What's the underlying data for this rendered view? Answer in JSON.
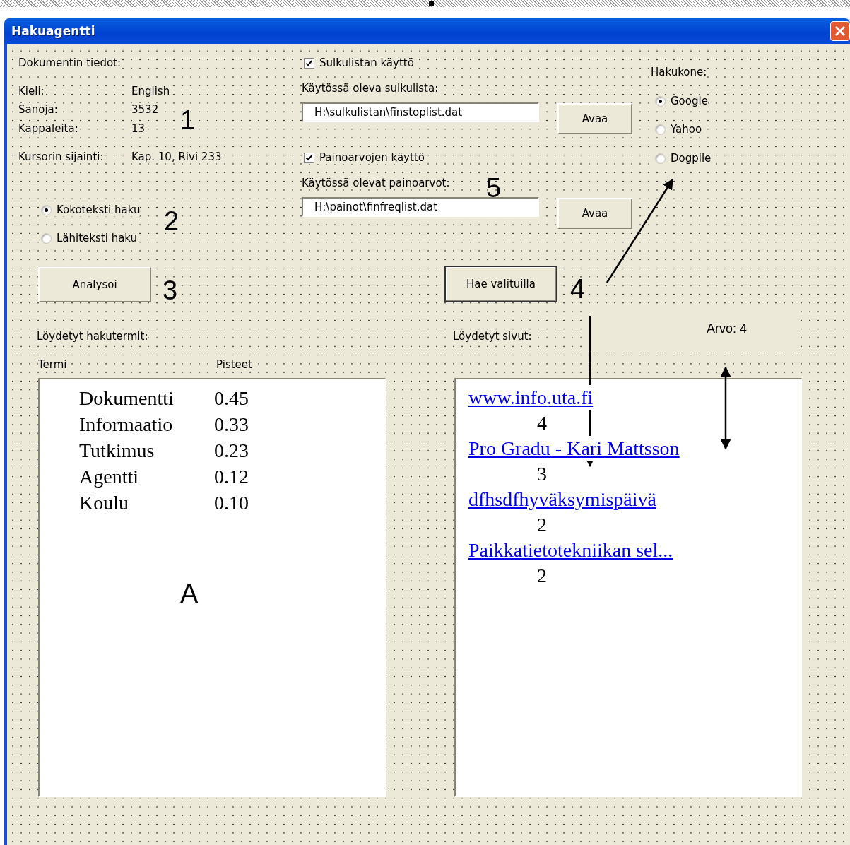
{
  "window": {
    "title": "Hakuagentti"
  },
  "document_info": {
    "heading": "Dokumentin tiedot:",
    "fields": [
      {
        "label": "Kieli:",
        "value": "English"
      },
      {
        "label": "Sanoja:",
        "value": "3532"
      },
      {
        "label": "Kappaleita:",
        "value": "13"
      },
      {
        "label": "Kursorin sijainti:",
        "value": "Kap. 10, Rivi 233"
      }
    ]
  },
  "search_mode": [
    {
      "label": "Kokoteksti haku",
      "selected": true
    },
    {
      "label": "Lähiteksti haku",
      "selected": false
    }
  ],
  "analyze_button": "Analysoi",
  "stoplist": {
    "checkbox": {
      "label": "Sulkulistan käyttö",
      "checked": true
    },
    "label": "Käytössä oleva sulkulista:",
    "value": "H:\\sulkulistan\\finstoplist.dat",
    "button": "Avaa"
  },
  "weights": {
    "checkbox": {
      "label": "Painoarvojen käyttö",
      "checked": true
    },
    "label": "Käytössä olevat painoarvot:",
    "value": "H:\\painot\\finfreqlist.dat",
    "button": "Avaa"
  },
  "search_engine": {
    "label": "Hakukone:",
    "options": [
      {
        "label": "Google",
        "selected": true
      },
      {
        "label": "Yahoo",
        "selected": false
      },
      {
        "label": "Dogpile",
        "selected": false
      }
    ]
  },
  "search_button": "Hae valituilla",
  "terms": {
    "label": "Löydetyt hakutermit:",
    "columns": [
      "Termi",
      "Pisteet"
    ],
    "rows": [
      {
        "term": "Dokumentti",
        "score": "0.45"
      },
      {
        "term": "Informaatio",
        "score": "0.33"
      },
      {
        "term": "Tutkimus",
        "score": "0.23"
      },
      {
        "term": "Agentti",
        "score": "0.12"
      },
      {
        "term": "Koulu",
        "score": "0.10"
      }
    ]
  },
  "pages": {
    "label": "Löydetyt sivut:",
    "value_label": "Arvo: 4",
    "results": [
      {
        "title": "www.info.uta.fi",
        "score": "4"
      },
      {
        "title": "Pro Gradu - Kari Mattsson",
        "score": "3"
      },
      {
        "title": "dfhsdfhyväksymispäivä",
        "score": "2"
      },
      {
        "title": "Paikkatietotekniikan sel...",
        "score": "2"
      }
    ]
  },
  "annotations": [
    "1",
    "2",
    "3",
    "4",
    "5",
    "A"
  ]
}
